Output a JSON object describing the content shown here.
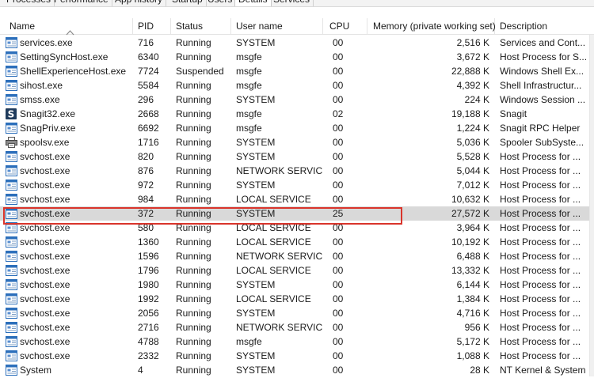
{
  "tabs": [
    "Processes",
    "Performance",
    "App history",
    "Startup",
    "Users",
    "Details",
    "Services"
  ],
  "active_tab": "Details",
  "columns": {
    "name": "Name",
    "pid": "PID",
    "status": "Status",
    "user": "User name",
    "cpu": "CPU",
    "memory": "Memory (private working set)",
    "description": "Description"
  },
  "rows": [
    {
      "icon": "window-icon",
      "name": "services.exe",
      "pid": "716",
      "status": "Running",
      "user": "SYSTEM",
      "cpu": "00",
      "memory": "2,516 K",
      "description": "Services and Cont..."
    },
    {
      "icon": "window-icon",
      "name": "SettingSyncHost.exe",
      "pid": "6340",
      "status": "Running",
      "user": "msgfe",
      "cpu": "00",
      "memory": "3,672 K",
      "description": "Host Process for S..."
    },
    {
      "icon": "window-icon",
      "name": "ShellExperienceHost.exe",
      "pid": "7724",
      "status": "Suspended",
      "user": "msgfe",
      "cpu": "00",
      "memory": "22,888 K",
      "description": "Windows Shell Ex..."
    },
    {
      "icon": "window-icon",
      "name": "sihost.exe",
      "pid": "5584",
      "status": "Running",
      "user": "msgfe",
      "cpu": "00",
      "memory": "4,392 K",
      "description": "Shell Infrastructur..."
    },
    {
      "icon": "window-icon",
      "name": "smss.exe",
      "pid": "296",
      "status": "Running",
      "user": "SYSTEM",
      "cpu": "00",
      "memory": "224 K",
      "description": "Windows Session ..."
    },
    {
      "icon": "snagit-icon",
      "name": "Snagit32.exe",
      "pid": "2668",
      "status": "Running",
      "user": "msgfe",
      "cpu": "02",
      "memory": "19,188 K",
      "description": "Snagit"
    },
    {
      "icon": "window-icon",
      "name": "SnagPriv.exe",
      "pid": "6692",
      "status": "Running",
      "user": "msgfe",
      "cpu": "00",
      "memory": "1,224 K",
      "description": "Snagit RPC Helper"
    },
    {
      "icon": "printer-icon",
      "name": "spoolsv.exe",
      "pid": "1716",
      "status": "Running",
      "user": "SYSTEM",
      "cpu": "00",
      "memory": "5,036 K",
      "description": "Spooler SubSyste..."
    },
    {
      "icon": "window-icon",
      "name": "svchost.exe",
      "pid": "820",
      "status": "Running",
      "user": "SYSTEM",
      "cpu": "00",
      "memory": "5,528 K",
      "description": "Host Process for ..."
    },
    {
      "icon": "window-icon",
      "name": "svchost.exe",
      "pid": "876",
      "status": "Running",
      "user": "NETWORK SERVICE",
      "cpu": "00",
      "memory": "5,044 K",
      "description": "Host Process for ..."
    },
    {
      "icon": "window-icon",
      "name": "svchost.exe",
      "pid": "972",
      "status": "Running",
      "user": "SYSTEM",
      "cpu": "00",
      "memory": "7,012 K",
      "description": "Host Process for ..."
    },
    {
      "icon": "window-icon",
      "name": "svchost.exe",
      "pid": "984",
      "status": "Running",
      "user": "LOCAL SERVICE",
      "cpu": "00",
      "memory": "10,632 K",
      "description": "Host Process for ..."
    },
    {
      "icon": "window-icon",
      "name": "svchost.exe",
      "pid": "372",
      "status": "Running",
      "user": "SYSTEM",
      "cpu": "25",
      "memory": "27,572 K",
      "description": "Host Process for ...",
      "selected": true
    },
    {
      "icon": "window-icon",
      "name": "svchost.exe",
      "pid": "580",
      "status": "Running",
      "user": "LOCAL SERVICE",
      "cpu": "00",
      "memory": "3,964 K",
      "description": "Host Process for ..."
    },
    {
      "icon": "window-icon",
      "name": "svchost.exe",
      "pid": "1360",
      "status": "Running",
      "user": "LOCAL SERVICE",
      "cpu": "00",
      "memory": "10,192 K",
      "description": "Host Process for ..."
    },
    {
      "icon": "window-icon",
      "name": "svchost.exe",
      "pid": "1596",
      "status": "Running",
      "user": "NETWORK SERVICE",
      "cpu": "00",
      "memory": "6,488 K",
      "description": "Host Process for ..."
    },
    {
      "icon": "window-icon",
      "name": "svchost.exe",
      "pid": "1796",
      "status": "Running",
      "user": "LOCAL SERVICE",
      "cpu": "00",
      "memory": "13,332 K",
      "description": "Host Process for ..."
    },
    {
      "icon": "window-icon",
      "name": "svchost.exe",
      "pid": "1980",
      "status": "Running",
      "user": "SYSTEM",
      "cpu": "00",
      "memory": "6,144 K",
      "description": "Host Process for ..."
    },
    {
      "icon": "window-icon",
      "name": "svchost.exe",
      "pid": "1992",
      "status": "Running",
      "user": "LOCAL SERVICE",
      "cpu": "00",
      "memory": "1,384 K",
      "description": "Host Process for ..."
    },
    {
      "icon": "window-icon",
      "name": "svchost.exe",
      "pid": "2056",
      "status": "Running",
      "user": "SYSTEM",
      "cpu": "00",
      "memory": "4,716 K",
      "description": "Host Process for ..."
    },
    {
      "icon": "window-icon",
      "name": "svchost.exe",
      "pid": "2716",
      "status": "Running",
      "user": "NETWORK SERVICE",
      "cpu": "00",
      "memory": "956 K",
      "description": "Host Process for ..."
    },
    {
      "icon": "window-icon",
      "name": "svchost.exe",
      "pid": "4788",
      "status": "Running",
      "user": "msgfe",
      "cpu": "00",
      "memory": "5,172 K",
      "description": "Host Process for ..."
    },
    {
      "icon": "window-icon",
      "name": "svchost.exe",
      "pid": "2332",
      "status": "Running",
      "user": "SYSTEM",
      "cpu": "00",
      "memory": "1,088 K",
      "description": "Host Process for ..."
    },
    {
      "icon": "window-icon",
      "name": "System",
      "pid": "4",
      "status": "Running",
      "user": "SYSTEM",
      "cpu": "00",
      "memory": "28 K",
      "description": "NT Kernel & System"
    }
  ],
  "colors": {
    "selected_row": "#d9d9d9",
    "highlight_border": "#d9342b",
    "snagit_icon": "#1f3b5c",
    "window_icon": "#2c6fbb"
  }
}
